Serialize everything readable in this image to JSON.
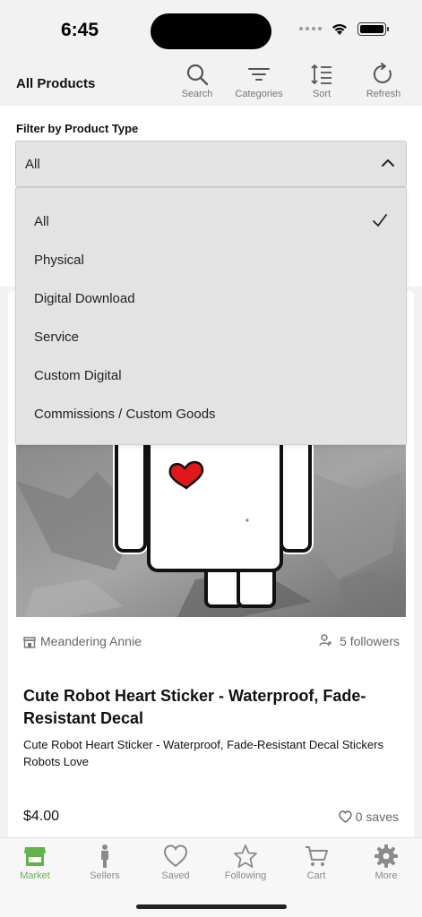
{
  "status_bar": {
    "time": "6:45"
  },
  "header": {
    "title": "All Products",
    "actions": [
      {
        "label": "Search",
        "icon": "search-icon"
      },
      {
        "label": "Categories",
        "icon": "categories-icon"
      },
      {
        "label": "Sort",
        "icon": "sort-icon"
      },
      {
        "label": "Refresh",
        "icon": "refresh-icon"
      }
    ]
  },
  "filter": {
    "label": "Filter by Product Type",
    "selected": "All",
    "options": [
      "All",
      "Physical",
      "Digital Download",
      "Service",
      "Custom Digital",
      "Commissions / Custom Goods"
    ]
  },
  "product": {
    "seller": "Meandering Annie",
    "followers": "5 followers",
    "title": "Cute Robot Heart Sticker - Waterproof, Fade-Resistant Decal",
    "description": "Cute Robot Heart Sticker - Waterproof, Fade-Resistant Decal Stickers Robots Love",
    "price": "$4.00",
    "saves": "0 saves"
  },
  "tabs": [
    {
      "label": "Market",
      "icon": "market-icon",
      "active": true
    },
    {
      "label": "Sellers",
      "icon": "sellers-icon",
      "active": false
    },
    {
      "label": "Saved",
      "icon": "heart-icon",
      "active": false
    },
    {
      "label": "Following",
      "icon": "star-icon",
      "active": false
    },
    {
      "label": "Cart",
      "icon": "cart-icon",
      "active": false
    },
    {
      "label": "More",
      "icon": "gear-icon",
      "active": false
    }
  ],
  "colors": {
    "accent": "#62b449",
    "heart": "#e3161b"
  }
}
